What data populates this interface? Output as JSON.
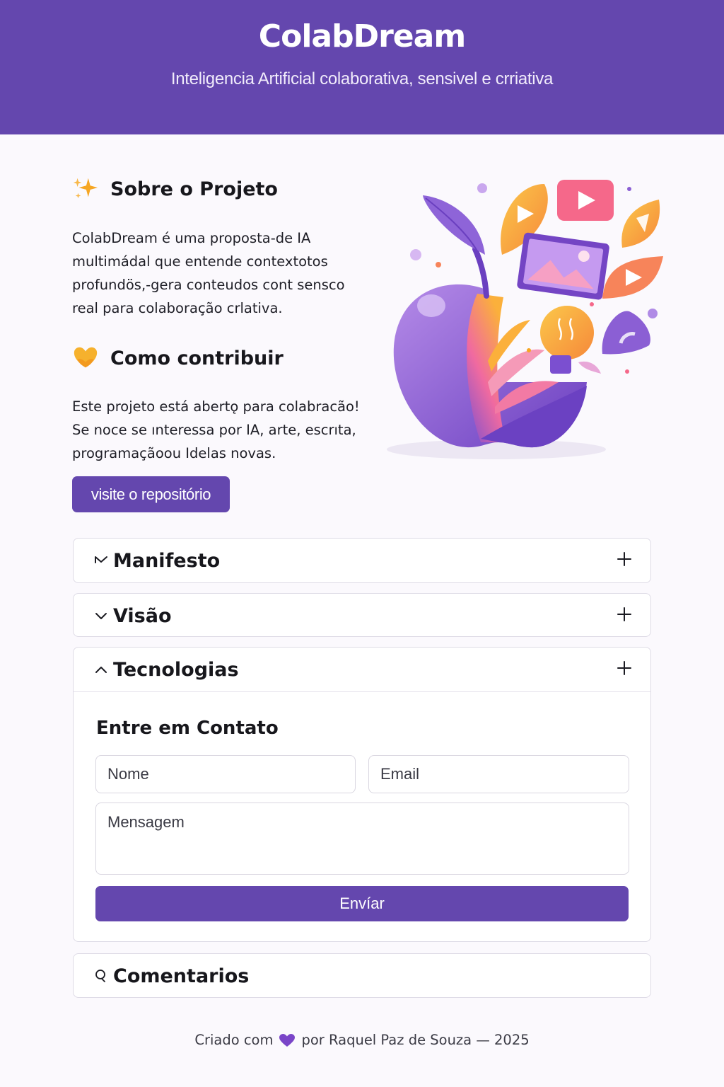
{
  "header": {
    "title": "ColabDream",
    "subtitle": "Inteligencia Artificial colaborativa, sensivel e crriativa"
  },
  "about": {
    "icon": "sparkles-icon",
    "title": "Sobre o Projeto",
    "text": "ColabDream é uma proposta-de IA multimádal que entende contextotos profundös,-gera conteudos cont sensco real para colaboração crlativa."
  },
  "contribute": {
    "icon": "heart-hands-icon",
    "title": "Como contribuir",
    "text": "Este projeto está abertǫ para colabracão! Se noce se ınteressa por IA, arte, escrıta, programaçãoou Idelas novas.",
    "button_label": "visite o repositório"
  },
  "accordions": [
    {
      "label": "Manifesto",
      "icon": "chevron-down-icon"
    },
    {
      "label": "Visão",
      "icon": "chevron-down-icon"
    },
    {
      "label": "Tecnologias",
      "icon": "chevron-up-icon"
    },
    {
      "label": "Comentarios",
      "icon": "comment-icon"
    }
  ],
  "contact": {
    "title": "Entre em Contato",
    "name_placeholder": "Nome",
    "email_placeholder": "Email",
    "message_placeholder": "Mensagem",
    "send_label": "Envíar"
  },
  "footer": {
    "prefix": "Criado com",
    "suffix": "por Raquel Paz de Souza — 2025"
  },
  "colors": {
    "brand": "#6447ae",
    "background": "#fbf9fd"
  }
}
